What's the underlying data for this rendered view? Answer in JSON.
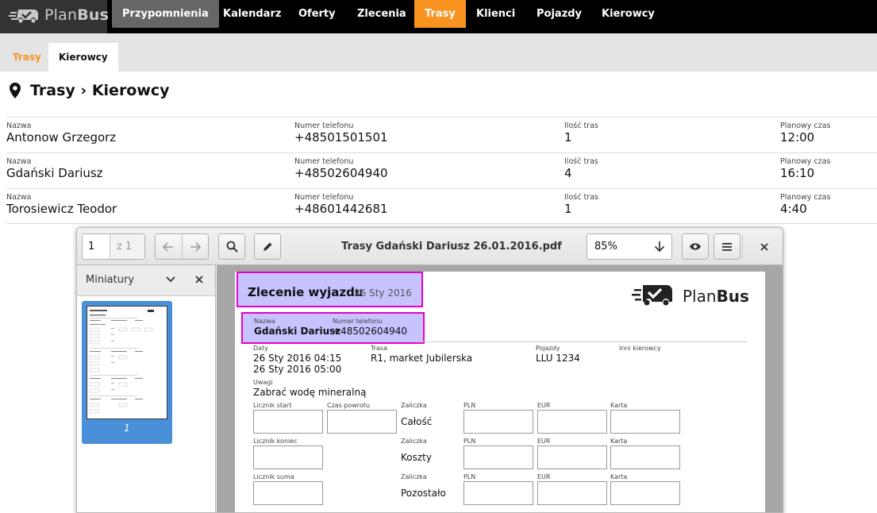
{
  "app": {
    "brand_light": "Plan",
    "brand_bold": "Bus",
    "colors": {
      "accent": "#f7931e",
      "topbar": "#000000",
      "highlight": "#e600c8"
    }
  },
  "nav": {
    "items": [
      {
        "label": "Przypomnienia",
        "state": "hover"
      },
      {
        "label": "Kalendarz"
      },
      {
        "label": "Oferty"
      },
      {
        "label": "Zlecenia"
      },
      {
        "label": "Trasy",
        "state": "active"
      },
      {
        "label": "Klienci"
      },
      {
        "label": "Pojazdy"
      },
      {
        "label": "Kierowcy"
      }
    ]
  },
  "subnav": {
    "tabs": [
      {
        "label": "Trasy"
      },
      {
        "label": "Kierowcy",
        "state": "active"
      }
    ]
  },
  "page": {
    "title": "Trasy › Kierowcy",
    "pin_icon": "map-marker-icon"
  },
  "table": {
    "headers": {
      "name": "Nazwa",
      "phone": "Numer telefonu",
      "routes": "Ilość tras",
      "time": "Planowy czas"
    },
    "rows": [
      {
        "name": "Antonow Grzegorz",
        "phone": "+48501501501",
        "routes": "1",
        "time": "12:00"
      },
      {
        "name": "Gdański Dariusz",
        "phone": "+48502604940",
        "routes": "4",
        "time": "16:10"
      },
      {
        "name": "Torosiewicz Teodor",
        "phone": "+48601442681",
        "routes": "1",
        "time": "4:40"
      }
    ]
  },
  "viewer": {
    "page_current": "1",
    "page_total": "z 1",
    "document_title": "Trasy Gdański Dariusz 26.01.2016.pdf",
    "zoom": "85%",
    "sidebar_title": "Miniatury",
    "thumb_label": "1",
    "icons": [
      "arrow-left-icon",
      "arrow-right-icon",
      "search-icon",
      "pencil-icon",
      "arrow-down-icon",
      "eye-icon",
      "menu-icon",
      "close-icon"
    ]
  },
  "pdf": {
    "heading": "Zlecenie wyjazdu",
    "heading_date": "26 Sty 2016",
    "brand_light": "Plan",
    "brand_bold": "Bus",
    "driver_label": "Nazwa",
    "driver_name": "Gdański Dariusz",
    "phone_label": "Numer telefonu",
    "phone": "+48502604940",
    "dates_label": "Daty",
    "date_start": "26 Sty 2016 04:15",
    "date_end": "26 Sty 2016 05:00",
    "route_label": "Trasa",
    "route": "R1, market Jubilerska",
    "vehicles_label": "Pojazdy",
    "vehicle": "LLU 1234",
    "other_drivers_label": "Inni kierowcy",
    "notes_label": "Uwagi",
    "notes": "Zabrać wodę mineralną",
    "counter_start": "Licznik start",
    "return_time": "Czas powrotu",
    "counter_end": "Licznik koniec",
    "counter_sum": "Licznik suma",
    "advance": "Zaliczka",
    "pln": "PLN",
    "eur": "EUR",
    "card": "Karta",
    "total": "Całość",
    "costs": "Koszty",
    "rest": "Pozostało"
  }
}
